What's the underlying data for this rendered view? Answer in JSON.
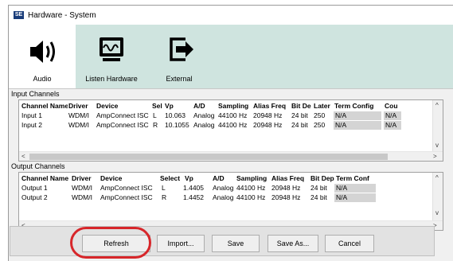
{
  "window": {
    "app_icon": "SE",
    "title": "Hardware - System"
  },
  "toolbar": [
    {
      "label": "Audio",
      "icon": "speaker-icon"
    },
    {
      "label": "Listen Hardware",
      "icon": "monitor-waveform-icon"
    },
    {
      "label": "External",
      "icon": "arrow-box-icon"
    }
  ],
  "input": {
    "section_label": "Input Channels",
    "headers": [
      "Channel Name",
      "Driver",
      "Device",
      "Sel",
      "Vp",
      "A/D",
      "Sampling",
      "Alias Freq",
      "Bit De",
      "Later",
      "Term Config",
      "Cou"
    ],
    "rows": [
      [
        "Input 1",
        "WDM/I",
        "AmpConnect ISC",
        "L",
        "10.063",
        "Analog",
        "44100 Hz",
        "20948 Hz",
        "24 bit",
        "250",
        "N/A",
        "N/A"
      ],
      [
        "Input 2",
        "WDM/I",
        "AmpConnect ISC",
        "R",
        "10.1055",
        "Analog",
        "44100 Hz",
        "20948 Hz",
        "24 bit",
        "250",
        "N/A",
        "N/A"
      ]
    ]
  },
  "output": {
    "section_label": "Output Channels",
    "headers": [
      "Channel Name",
      "Driver",
      "Device",
      "Select",
      "Vp",
      "A/D",
      "Sampling",
      "Alias Freq",
      "Bit Dep",
      "Term Conf"
    ],
    "rows": [
      [
        "Output 1",
        "WDM/I",
        "AmpConnect ISC",
        "L",
        "1.4405",
        "Analog",
        "44100 Hz",
        "20948 Hz",
        "24 bit",
        "N/A"
      ],
      [
        "Output 2",
        "WDM/I",
        "AmpConnect ISC",
        "R",
        "1.4452",
        "Analog",
        "44100 Hz",
        "20948 Hz",
        "24 bit",
        "N/A"
      ]
    ]
  },
  "buttons": {
    "refresh": "Refresh",
    "import": "Import...",
    "save": "Save",
    "save_as": "Save As...",
    "cancel": "Cancel"
  },
  "scroll_glyphs": {
    "up": "^",
    "down": "v",
    "left": "<",
    "right": ">"
  },
  "colors": {
    "toolbar_selected_bg": "#cfe4df",
    "highlight_ring": "#d7262a",
    "na_cell_bg": "#d4d4d4"
  }
}
